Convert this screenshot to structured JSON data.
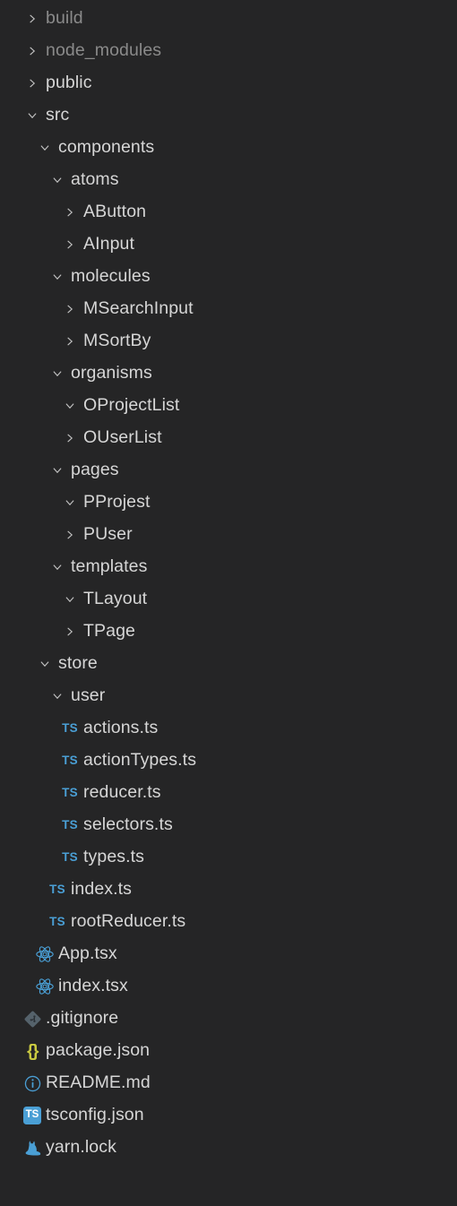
{
  "theme": {
    "background": "#252526",
    "text": "#d6d6d6",
    "text_dim": "#8a8a8a",
    "chevron": "#c5c5c5",
    "ts_blue": "#4a9fd5",
    "react_blue": "#4a9fd5",
    "json_yellow": "#cbcb41",
    "git_gray": "#55626b",
    "readme_blue": "#4a9fd5",
    "yarn_blue": "#4a9fd5"
  },
  "tree": {
    "name": "file-explorer-tree",
    "items": [
      {
        "label": "build",
        "depth": 0,
        "kind": "folder",
        "state": "collapsed",
        "icon": "chevron-right-icon",
        "dim": true
      },
      {
        "label": "node_modules",
        "depth": 0,
        "kind": "folder",
        "state": "collapsed",
        "icon": "chevron-right-icon",
        "dim": true
      },
      {
        "label": "public",
        "depth": 0,
        "kind": "folder",
        "state": "collapsed",
        "icon": "chevron-right-icon",
        "dim": false
      },
      {
        "label": "src",
        "depth": 0,
        "kind": "folder",
        "state": "expanded",
        "icon": "chevron-down-icon",
        "dim": false
      },
      {
        "label": "components",
        "depth": 1,
        "kind": "folder",
        "state": "expanded",
        "icon": "chevron-down-icon",
        "dim": false
      },
      {
        "label": "atoms",
        "depth": 2,
        "kind": "folder",
        "state": "expanded",
        "icon": "chevron-down-icon",
        "dim": false
      },
      {
        "label": "AButton",
        "depth": 3,
        "kind": "folder",
        "state": "collapsed",
        "icon": "chevron-right-icon",
        "dim": false
      },
      {
        "label": "AInput",
        "depth": 3,
        "kind": "folder",
        "state": "collapsed",
        "icon": "chevron-right-icon",
        "dim": false
      },
      {
        "label": "molecules",
        "depth": 2,
        "kind": "folder",
        "state": "expanded",
        "icon": "chevron-down-icon",
        "dim": false
      },
      {
        "label": "MSearchInput",
        "depth": 3,
        "kind": "folder",
        "state": "collapsed",
        "icon": "chevron-right-icon",
        "dim": false
      },
      {
        "label": "MSortBy",
        "depth": 3,
        "kind": "folder",
        "state": "collapsed",
        "icon": "chevron-right-icon",
        "dim": false
      },
      {
        "label": "organisms",
        "depth": 2,
        "kind": "folder",
        "state": "expanded",
        "icon": "chevron-down-icon",
        "dim": false
      },
      {
        "label": "OProjectList",
        "depth": 3,
        "kind": "folder",
        "state": "expanded",
        "icon": "chevron-down-icon",
        "dim": false
      },
      {
        "label": "OUserList",
        "depth": 3,
        "kind": "folder",
        "state": "collapsed",
        "icon": "chevron-right-icon",
        "dim": false
      },
      {
        "label": "pages",
        "depth": 2,
        "kind": "folder",
        "state": "expanded",
        "icon": "chevron-down-icon",
        "dim": false
      },
      {
        "label": "PProjest",
        "depth": 3,
        "kind": "folder",
        "state": "expanded",
        "icon": "chevron-down-icon",
        "dim": false
      },
      {
        "label": "PUser",
        "depth": 3,
        "kind": "folder",
        "state": "collapsed",
        "icon": "chevron-right-icon",
        "dim": false
      },
      {
        "label": "templates",
        "depth": 2,
        "kind": "folder",
        "state": "expanded",
        "icon": "chevron-down-icon",
        "dim": false
      },
      {
        "label": "TLayout",
        "depth": 3,
        "kind": "folder",
        "state": "expanded",
        "icon": "chevron-down-icon",
        "dim": false
      },
      {
        "label": "TPage",
        "depth": 3,
        "kind": "folder",
        "state": "collapsed",
        "icon": "chevron-right-icon",
        "dim": false
      },
      {
        "label": "store",
        "depth": 1,
        "kind": "folder",
        "state": "expanded",
        "icon": "chevron-down-icon",
        "dim": false
      },
      {
        "label": "user",
        "depth": 2,
        "kind": "folder",
        "state": "expanded",
        "icon": "chevron-down-icon",
        "dim": false
      },
      {
        "label": "actions.ts",
        "depth": 3,
        "kind": "file",
        "state": "",
        "icon": "typescript-icon",
        "dim": false
      },
      {
        "label": "actionTypes.ts",
        "depth": 3,
        "kind": "file",
        "state": "",
        "icon": "typescript-icon",
        "dim": false
      },
      {
        "label": "reducer.ts",
        "depth": 3,
        "kind": "file",
        "state": "",
        "icon": "typescript-icon",
        "dim": false
      },
      {
        "label": "selectors.ts",
        "depth": 3,
        "kind": "file",
        "state": "",
        "icon": "typescript-icon",
        "dim": false
      },
      {
        "label": "types.ts",
        "depth": 3,
        "kind": "file",
        "state": "",
        "icon": "typescript-icon",
        "dim": false
      },
      {
        "label": "index.ts",
        "depth": 2,
        "kind": "file",
        "state": "",
        "icon": "typescript-icon",
        "dim": false
      },
      {
        "label": "rootReducer.ts",
        "depth": 2,
        "kind": "file",
        "state": "",
        "icon": "typescript-icon",
        "dim": false
      },
      {
        "label": "App.tsx",
        "depth": 1,
        "kind": "file",
        "state": "",
        "icon": "react-icon",
        "dim": false
      },
      {
        "label": "index.tsx",
        "depth": 1,
        "kind": "file",
        "state": "",
        "icon": "react-icon",
        "dim": false
      },
      {
        "label": ".gitignore",
        "depth": 0,
        "kind": "file",
        "state": "",
        "icon": "git-icon",
        "dim": false
      },
      {
        "label": "package.json",
        "depth": 0,
        "kind": "file",
        "state": "",
        "icon": "json-braces-icon",
        "dim": false
      },
      {
        "label": "README.md",
        "depth": 0,
        "kind": "file",
        "state": "",
        "icon": "info-circle-icon",
        "dim": false
      },
      {
        "label": "tsconfig.json",
        "depth": 0,
        "kind": "file",
        "state": "",
        "icon": "typescript-badge-icon",
        "dim": false
      },
      {
        "label": "yarn.lock",
        "depth": 0,
        "kind": "file",
        "state": "",
        "icon": "yarn-cat-icon",
        "dim": false
      }
    ]
  }
}
